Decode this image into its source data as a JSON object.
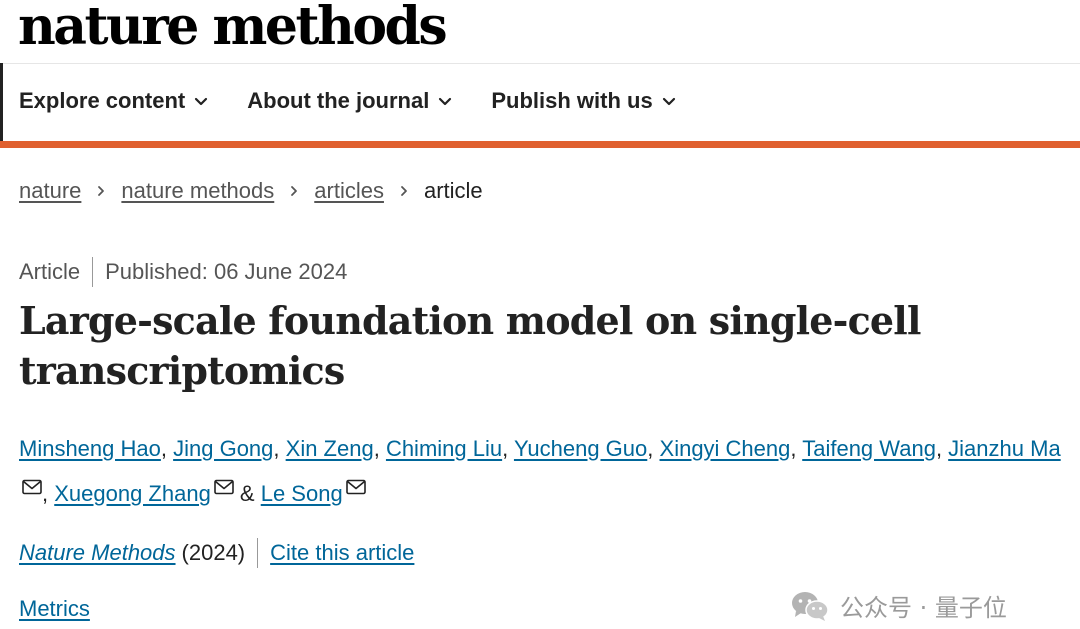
{
  "site": {
    "logo": "nature methods"
  },
  "nav": {
    "items": [
      {
        "label": "Explore content",
        "icon": "chevron-down-icon"
      },
      {
        "label": "About the journal",
        "icon": "chevron-down-icon"
      },
      {
        "label": "Publish with us",
        "icon": "chevron-down-icon"
      }
    ]
  },
  "colors": {
    "accent": "#e0602f",
    "link": "#006699",
    "text": "#222222",
    "muted": "#555555"
  },
  "breadcrumb": {
    "items": [
      {
        "label": "nature"
      },
      {
        "label": "nature methods"
      },
      {
        "label": "articles"
      },
      {
        "label": "article"
      }
    ]
  },
  "article": {
    "type": "Article",
    "published": "Published: 06 June 2024",
    "title": "Large-scale foundation model on single-cell transcriptomics",
    "authors": [
      {
        "name": "Minsheng Hao",
        "sep": ", "
      },
      {
        "name": "Jing Gong",
        "sep": ", "
      },
      {
        "name": "Xin Zeng",
        "sep": ", "
      },
      {
        "name": "Chiming Liu",
        "sep": ", "
      },
      {
        "name": "Yucheng Guo",
        "sep": ", "
      },
      {
        "name": "Xingyi Cheng",
        "sep": ", "
      },
      {
        "name": "Taifeng Wang",
        "sep": ", "
      },
      {
        "name": "Jianzhu Ma",
        "sep": ", ",
        "mail": true
      },
      {
        "name": "Xuegong Zhang",
        "sep": " & ",
        "mail": true
      },
      {
        "name": "Le Song",
        "sep": "",
        "mail": true
      }
    ],
    "journal": "Nature Methods",
    "year": "(2024)",
    "cite": "Cite this article",
    "metrics": "Metrics"
  },
  "watermark": {
    "text": "公众号 · 量子位",
    "icon": "wechat-icon"
  }
}
